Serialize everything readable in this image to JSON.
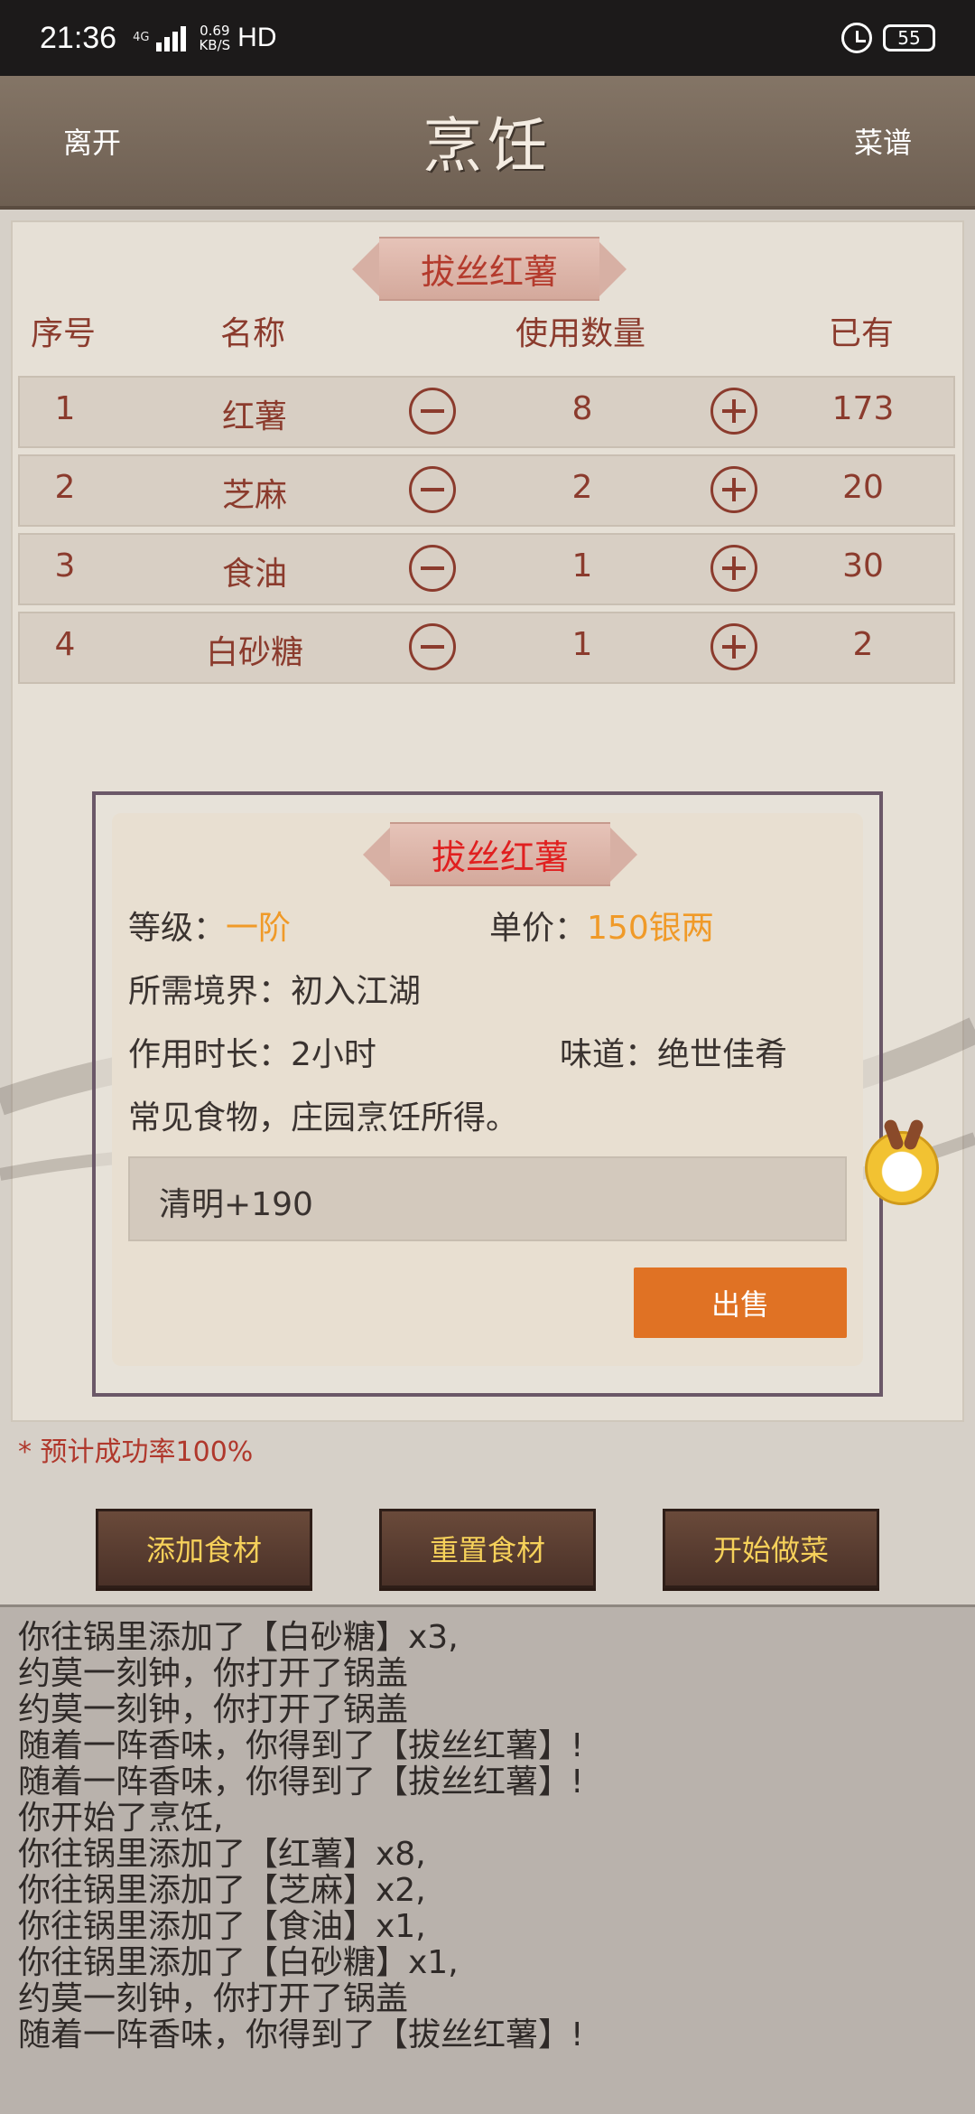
{
  "status_bar": {
    "time": "21:36",
    "network": "4G",
    "speed_value": "0.69",
    "speed_unit": "KB/S",
    "hd": "HD",
    "battery": "55"
  },
  "header": {
    "left": "离开",
    "title": "烹饪",
    "right": "菜谱"
  },
  "recipe_title": "拔丝红薯",
  "table": {
    "headers": [
      "序号",
      "名称",
      "使用数量",
      "已有"
    ],
    "rows": [
      {
        "index": "1",
        "name": "红薯",
        "qty": "8",
        "owned": "173"
      },
      {
        "index": "2",
        "name": "芝麻",
        "qty": "2",
        "owned": "20"
      },
      {
        "index": "3",
        "name": "食油",
        "qty": "1",
        "owned": "30"
      },
      {
        "index": "4",
        "name": "白砂糖",
        "qty": "1",
        "owned": "2"
      }
    ]
  },
  "popup": {
    "title": "拔丝红薯",
    "level_label": "等级：",
    "level_value": "一阶",
    "price_label": "单价：",
    "price_value": "150银两",
    "realm": "所需境界：初入江湖",
    "duration": "作用时长：2小时",
    "taste": "味道：绝世佳肴",
    "desc": "常见食物，庄园烹饪所得。",
    "bonus": "清明+190",
    "sell_button": "出售"
  },
  "success_rate": "* 预计成功率100%",
  "actions": {
    "add": "添加食材",
    "reset": "重置食材",
    "start": "开始做菜"
  },
  "log": [
    "你往锅里添加了【白砂糖】x3,",
    "约莫一刻钟，你打开了锅盖",
    "约莫一刻钟，你打开了锅盖",
    "随着一阵香味，你得到了【拔丝红薯】!",
    "随着一阵香味，你得到了【拔丝红薯】!",
    "你开始了烹饪,",
    "你往锅里添加了【红薯】x8,",
    "你往锅里添加了【芝麻】x2,",
    "你往锅里添加了【食油】x1,",
    "你往锅里添加了【白砂糖】x1,",
    "约莫一刻钟，你打开了锅盖",
    "随着一阵香味，你得到了【拔丝红薯】!"
  ],
  "colors": {
    "header_bg": "#7a6b5c",
    "text_red": "#8b3b2d",
    "accent_orange": "#f09a28",
    "sell_button": "#e07224",
    "action_text": "#f6d15a"
  }
}
